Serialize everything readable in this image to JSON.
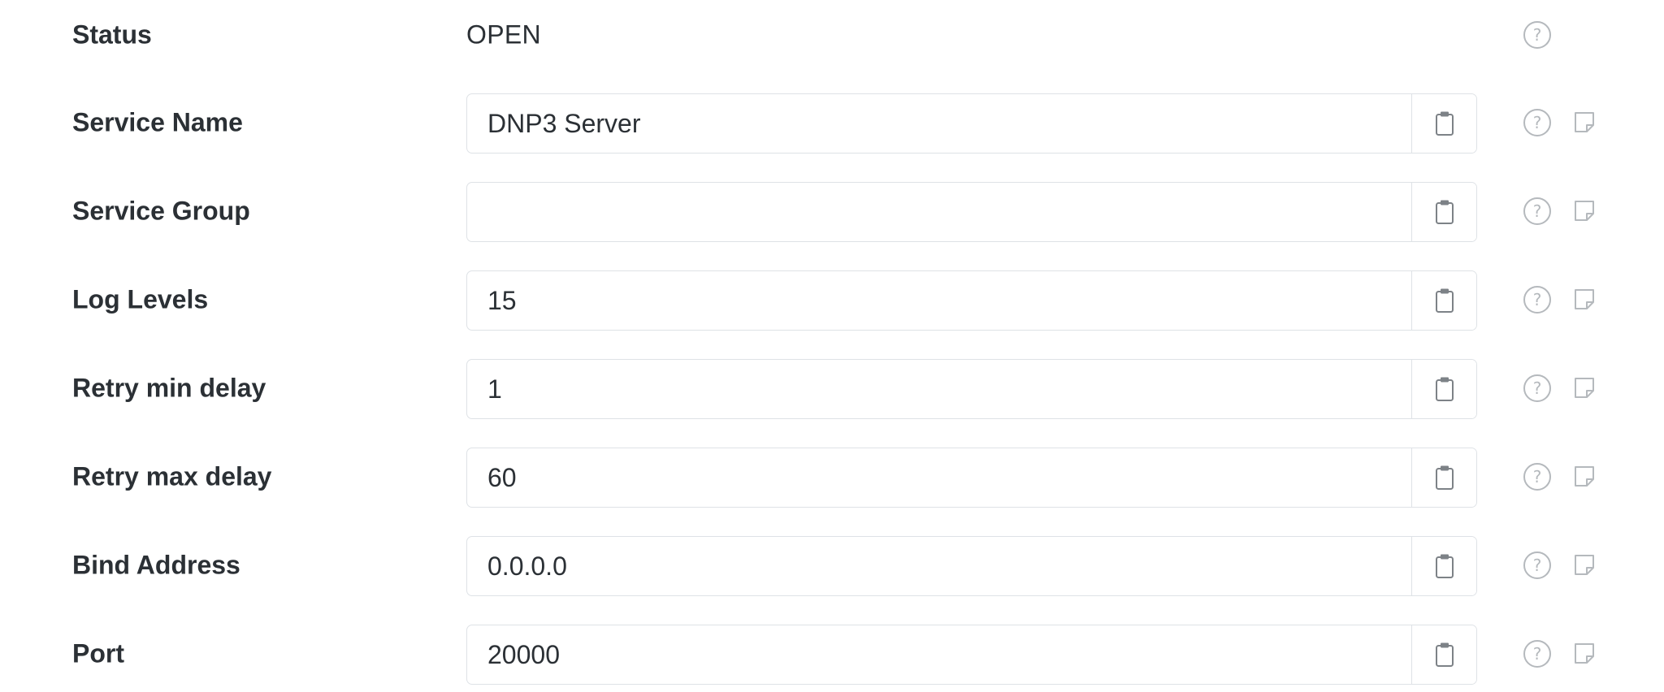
{
  "form": {
    "status": {
      "label": "Status",
      "value": "OPEN"
    },
    "fields": [
      {
        "label": "Service Name",
        "value": "DNP3 Server"
      },
      {
        "label": "Service Group",
        "value": ""
      },
      {
        "label": "Log Levels",
        "value": "15"
      },
      {
        "label": "Retry min delay",
        "value": "1"
      },
      {
        "label": "Retry max delay",
        "value": "60"
      },
      {
        "label": "Bind Address",
        "value": "0.0.0.0"
      },
      {
        "label": "Port",
        "value": "20000"
      }
    ]
  },
  "icons": {
    "help": "help-circle-icon",
    "copy": "clipboard-icon",
    "note": "note-icon"
  },
  "colors": {
    "label_text": "#2b3035",
    "border": "#dee2e6",
    "icon_muted": "#b5b9bd",
    "clipboard_icon": "#7d8287"
  }
}
